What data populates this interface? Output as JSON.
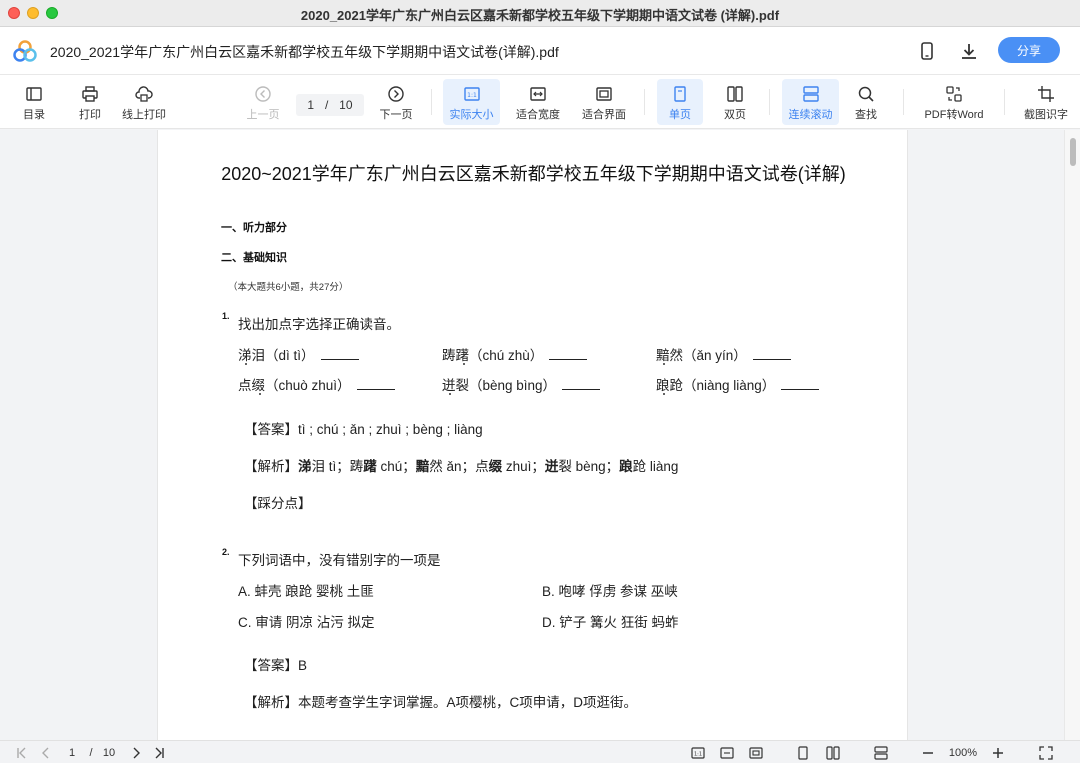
{
  "window": {
    "title": "2020_2021学年广东广州白云区嘉禾新都学校五年级下学期期中语文试卷 (详解).pdf"
  },
  "header": {
    "doc_title": "2020_2021学年广东广州白云区嘉禾新都学校五年级下学期期中语文试卷(详解).pdf",
    "share_label": "分享"
  },
  "toolbar": {
    "toc": "目录",
    "print": "打印",
    "online_print": "线上打印",
    "prev": "上一页",
    "current_page": "1",
    "separator": "/",
    "total_pages": "10",
    "next": "下一页",
    "actual_size": "实际大小",
    "actual_size_glyph": "1:1",
    "fit_width": "适合宽度",
    "fit_page": "适合界面",
    "single_page": "单页",
    "double_page": "双页",
    "continuous": "连续滚动",
    "find": "查找",
    "pdf_to_word": "PDF转Word",
    "ocr": "截图识字"
  },
  "document": {
    "title": "2020~2021学年广东广州白云区嘉禾新都学校五年级下学期期中语文试卷(详解)",
    "section1": "一、听力部分",
    "section2": "二、基础知识",
    "section2_note": "（本大题共6小题，共27分）",
    "q1": {
      "num": "1.",
      "stem": "找出加点字选择正确读音。",
      "items": [
        "涕泪（dì tì）",
        "踌躇（chú zhù）",
        "黯然（ǎn yín）",
        "点缀（chuò zhuì）",
        "迸裂（bèng bìng）",
        "踉跄（niàng liàng）"
      ],
      "answer_label": "【答案】",
      "answer": "tì ; chú ; ǎn ; zhuì ; bèng ; liàng",
      "analysis_label": "【解析】",
      "analysis": [
        {
          "b": "涕",
          "t": "泪 tì；踌"
        },
        {
          "b": "躇",
          "t": " chú；"
        },
        {
          "b": "黯",
          "t": "然 ǎn；点"
        },
        {
          "b": "缀",
          "t": " zhuì；"
        },
        {
          "b": "迸",
          "t": "裂 bèng；"
        },
        {
          "b": "踉",
          "t": "跄 liàng"
        }
      ],
      "points_label": "【踩分点】"
    },
    "q2": {
      "num": "2.",
      "stem": "下列词语中，没有错别字的一项是",
      "options": [
        "A. 蚌壳 踉跄 婴桃 土匪",
        "B. 咆哮 俘虏 参谋 巫峡",
        "C. 审请 阴凉 沾污 拟定",
        "D. 铲子 篝火 狂街 蚂蚱"
      ],
      "answer_label": "【答案】",
      "answer": "B",
      "analysis_label": "【解析】",
      "analysis": "本题考查学生字词掌握。A项樱桃，C项申请，D项逛街。"
    }
  },
  "bottombar": {
    "current_page": "1",
    "separator": "/",
    "total_pages": "10",
    "zoom": "100%",
    "fit_glyph": "1:1"
  },
  "colors": {
    "accent": "#4a90f5",
    "active_bg": "#e8f1fd",
    "active_text": "#3d83f0"
  }
}
